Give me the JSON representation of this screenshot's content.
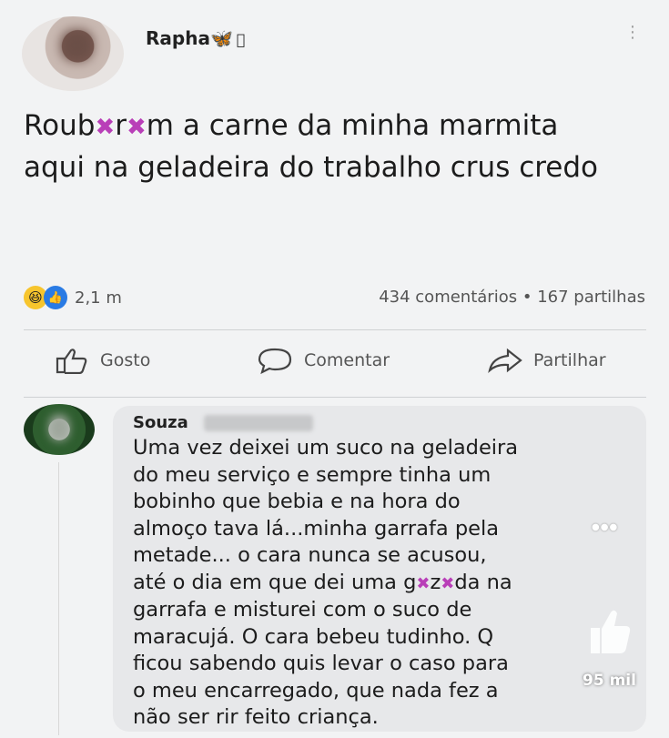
{
  "post": {
    "username": "Rapha",
    "username_emoji": "🦋",
    "username_suffix": "",
    "text_parts": [
      "Roub",
      "r",
      "m a carne da minha marmita aqui na geladeira do trabalho crus credo"
    ],
    "censor_glyph": "✖"
  },
  "reactions": {
    "haha_icon": "😆",
    "like_icon": "👍",
    "count": "2,1 m"
  },
  "stats": {
    "comments": "434 comentários",
    "separator": "•",
    "shares": "167 partilhas"
  },
  "actions": {
    "like_label": "Gosto",
    "comment_label": "Comentar",
    "share_label": "Partilhar"
  },
  "comment": {
    "author": "Souza",
    "lines": [
      "Uma vez deixei um suco na geladeira",
      "do meu serviço e sempre tinha um",
      "bobinho que bebia e na hora do",
      "almoço tava lá...minha garrafa pela",
      "metade... o cara nunca se acusou,",
      "até o dia em que dei uma g",
      "z",
      "da na",
      "garrafa e misturei com o suco de",
      "maracujá. O cara bebeu tudinho. Q",
      "ficou sabendo quis levar o caso para",
      "o meu encarregado,  que nada fez a",
      "não ser rir feito criança."
    ]
  },
  "overlay": {
    "dots": "●●●",
    "like_count": "95 mil"
  },
  "colors": {
    "background": "#f2f3f4",
    "bubble": "#e7e8ea",
    "censor": "#b93fb8",
    "like_blue": "#2a7be4"
  }
}
